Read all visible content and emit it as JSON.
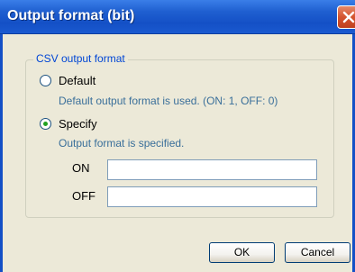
{
  "window": {
    "title": "Output format (bit)"
  },
  "group": {
    "label": "CSV output format"
  },
  "options": {
    "default": {
      "label": "Default",
      "description": "Default output format is used. (ON: 1, OFF: 0)",
      "selected": false
    },
    "specify": {
      "label": "Specify",
      "description": "Output format is specified.",
      "selected": true
    }
  },
  "fields": {
    "on": {
      "label": "ON",
      "value": ""
    },
    "off": {
      "label": "OFF",
      "value": ""
    }
  },
  "buttons": {
    "ok": "OK",
    "cancel": "Cancel"
  },
  "colors": {
    "titlebar": "#1450c6",
    "dialog_bg": "#ece9d8",
    "group_label": "#0046d5",
    "description": "#3a6f9a",
    "radio_dot": "#21a121",
    "close_button": "#d4542f"
  },
  "icons": {
    "close": "close-icon"
  }
}
